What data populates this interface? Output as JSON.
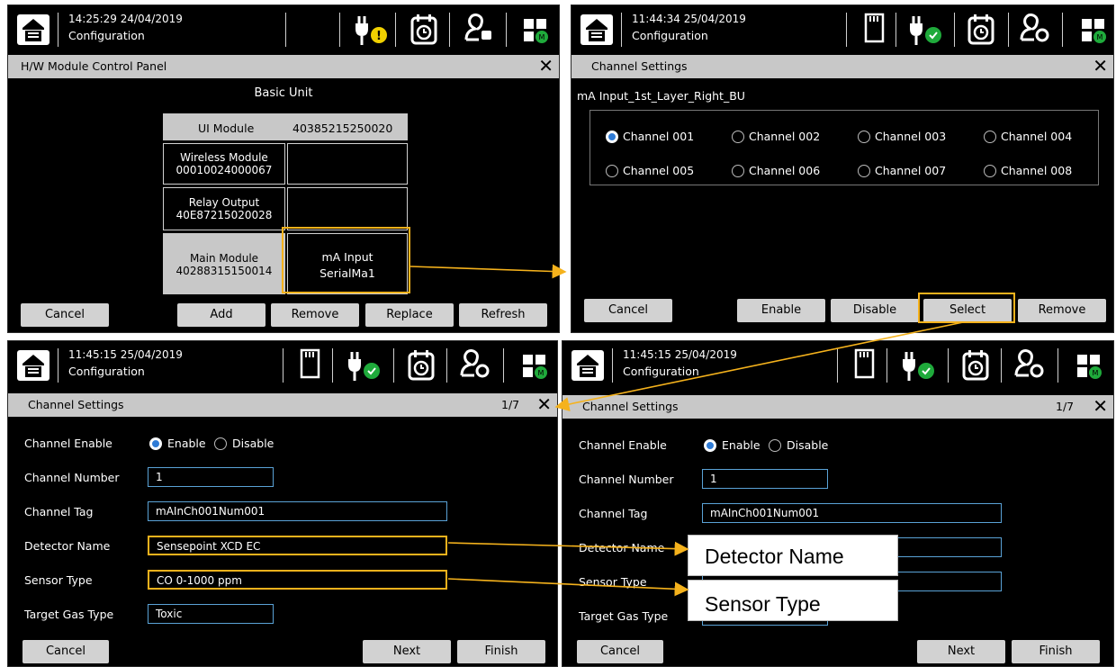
{
  "panel1": {
    "time": "14:25:29  24/04/2019",
    "subtitle": "Configuration",
    "dialog_title": "H/W Module Control Panel",
    "unit_title": "Basic Unit",
    "ui_module_label": "UI Module",
    "ui_module_serial": "40385215250020",
    "wireless_line1": "Wireless Module",
    "wireless_line2": "00010024000067",
    "relay_line1": "Relay Output",
    "relay_line2": "40E87215020028",
    "main_line1": "Main Module",
    "main_line2": "40288315150014",
    "ma_line1": "mA Input",
    "ma_line2": "SerialMa1",
    "buttons": [
      "Cancel",
      "Add",
      "Remove",
      "Replace",
      "Refresh"
    ]
  },
  "panel2": {
    "time": "11:44:34  25/04/2019",
    "subtitle": "Configuration",
    "dialog_title": "Channel Settings",
    "module_name": "mA Input_1st_Layer_Right_BU",
    "channels": [
      "Channel 001",
      "Channel 002",
      "Channel 003",
      "Channel 004",
      "Channel 005",
      "Channel 006",
      "Channel 007",
      "Channel 008"
    ],
    "selected_channel": "Channel 001",
    "buttons": [
      "Cancel",
      "Enable",
      "Disable",
      "Select",
      "Remove"
    ]
  },
  "panel3": {
    "time": "11:45:15  25/04/2019",
    "subtitle": "Configuration",
    "dialog_title": "Channel Settings",
    "page": "1/7",
    "labels": [
      "Channel Enable",
      "Channel Number",
      "Channel Tag",
      "Detector Name",
      "Sensor Type",
      "Target Gas Type"
    ],
    "enable": "Enable",
    "disable": "Disable",
    "channel_number": "1",
    "channel_tag": "mAInCh001Num001",
    "detector_name": "Sensepoint XCD EC",
    "sensor_type": "CO 0-1000 ppm",
    "target_gas": "Toxic",
    "buttons": [
      "Cancel",
      "Next",
      "Finish"
    ]
  },
  "panel4": {
    "time": "11:45:15  25/04/2019",
    "subtitle": "Configuration",
    "dialog_title": "Channel Settings",
    "page": "1/7",
    "labels": [
      "Channel Enable",
      "Channel Number",
      "Channel Tag",
      "Detector Name",
      "Sensor Type",
      "Target Gas Type"
    ],
    "enable": "Enable",
    "disable": "Disable",
    "channel_number": "1",
    "channel_tag": "mAInCh001Num001",
    "buttons": [
      "Cancel",
      "Next",
      "Finish"
    ]
  },
  "callouts": {
    "detector": "Detector Name",
    "sensor": "Sensor Type"
  },
  "colors": {
    "highlight": "#f5b21c",
    "field_border": "#5aa2d6",
    "ok_green": "#1faa3b",
    "warn_yellow": "#f0d000"
  }
}
